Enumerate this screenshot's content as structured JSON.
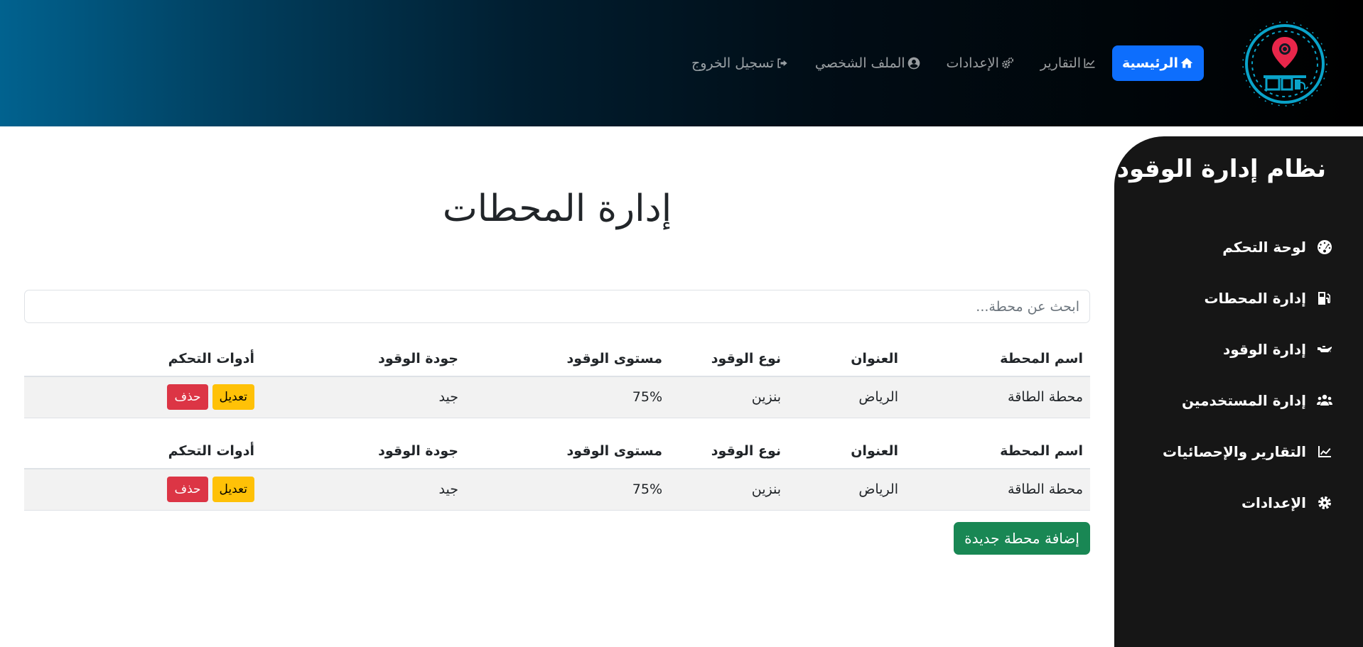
{
  "header": {
    "nav": [
      {
        "label": "الرئيسية",
        "icon": "home-icon",
        "active": true
      },
      {
        "label": "التقارير",
        "icon": "chart-line-icon"
      },
      {
        "label": "الإعدادات",
        "icon": "gears-icon"
      },
      {
        "label": "الملف الشخصي",
        "icon": "user-circle-icon"
      },
      {
        "label": "تسجيل الخروج",
        "icon": "sign-out-icon"
      }
    ],
    "colors": {
      "active": "#0d6efd",
      "gradient_start": "#01628f",
      "gradient_end": "#000000"
    }
  },
  "sidebar": {
    "title": "نظام إدارة الوقود",
    "items": [
      {
        "label": "لوحة التحكم",
        "icon": "gauge-icon"
      },
      {
        "label": "إدارة المحطات",
        "icon": "gas-pump-icon"
      },
      {
        "label": "إدارة الوقود",
        "icon": "oil-can-icon"
      },
      {
        "label": "إدارة المستخدمين",
        "icon": "users-icon"
      },
      {
        "label": "التقارير والإحصائيات",
        "icon": "chart-line-icon"
      },
      {
        "label": "الإعدادات",
        "icon": "gear-icon"
      }
    ]
  },
  "main": {
    "title": "إدارة المحطات",
    "search_placeholder": "ابحث عن محطة...",
    "columns": [
      "اسم المحطة",
      "العنوان",
      "نوع الوقود",
      "مستوى الوقود",
      "جودة الوقود",
      "أدوات التحكم"
    ],
    "tables": [
      {
        "rows": [
          {
            "name": "محطة الطاقة",
            "address": "الرياض",
            "fuel_type": "بنزين",
            "level": "75%",
            "quality": "جيد"
          }
        ]
      },
      {
        "rows": [
          {
            "name": "محطة الطاقة",
            "address": "الرياض",
            "fuel_type": "بنزين",
            "level": "75%",
            "quality": "جيد"
          }
        ]
      }
    ],
    "edit_label": "تعديل",
    "delete_label": "حذف",
    "add_label": "إضافة محطة جديدة"
  }
}
